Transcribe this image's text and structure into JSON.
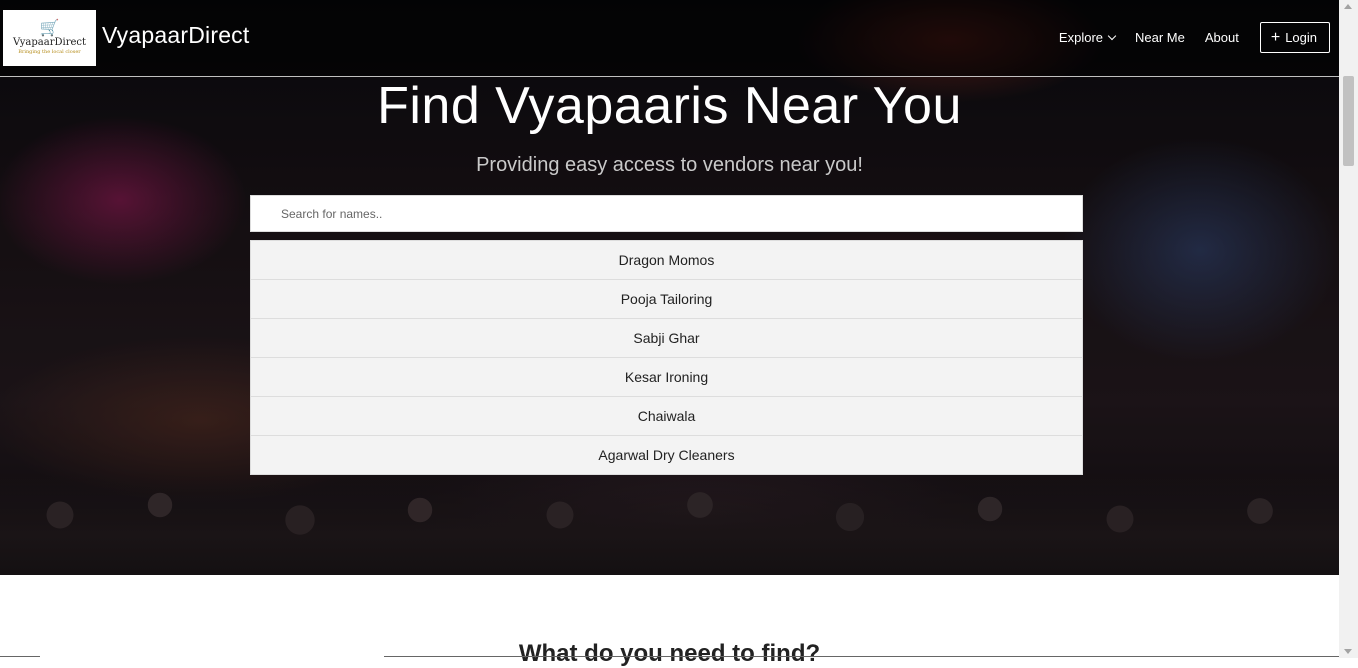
{
  "brand": {
    "logo_text": "VyapaarDirect",
    "logo_tagline": "Bringing the local closer",
    "name": "VyapaarDirect"
  },
  "nav": {
    "explore": "Explore",
    "near_me": "Near Me",
    "about": "About",
    "login": "Login"
  },
  "hero": {
    "title": "Find Vyapaaris Near You",
    "subtitle": "Providing easy access to vendors near you!"
  },
  "search": {
    "placeholder": "Search for names..",
    "value": ""
  },
  "vendors": [
    "Dragon Momos",
    "Pooja Tailoring",
    "Sabji Ghar",
    "Kesar Ironing",
    "Chaiwala",
    "Agarwal Dry Cleaners"
  ],
  "section": {
    "heading": "What do you need to find?"
  },
  "icons": {
    "logo": "shopping-cart-icon",
    "explore_dropdown": "chevron-down-icon",
    "login": "plus-icon"
  }
}
